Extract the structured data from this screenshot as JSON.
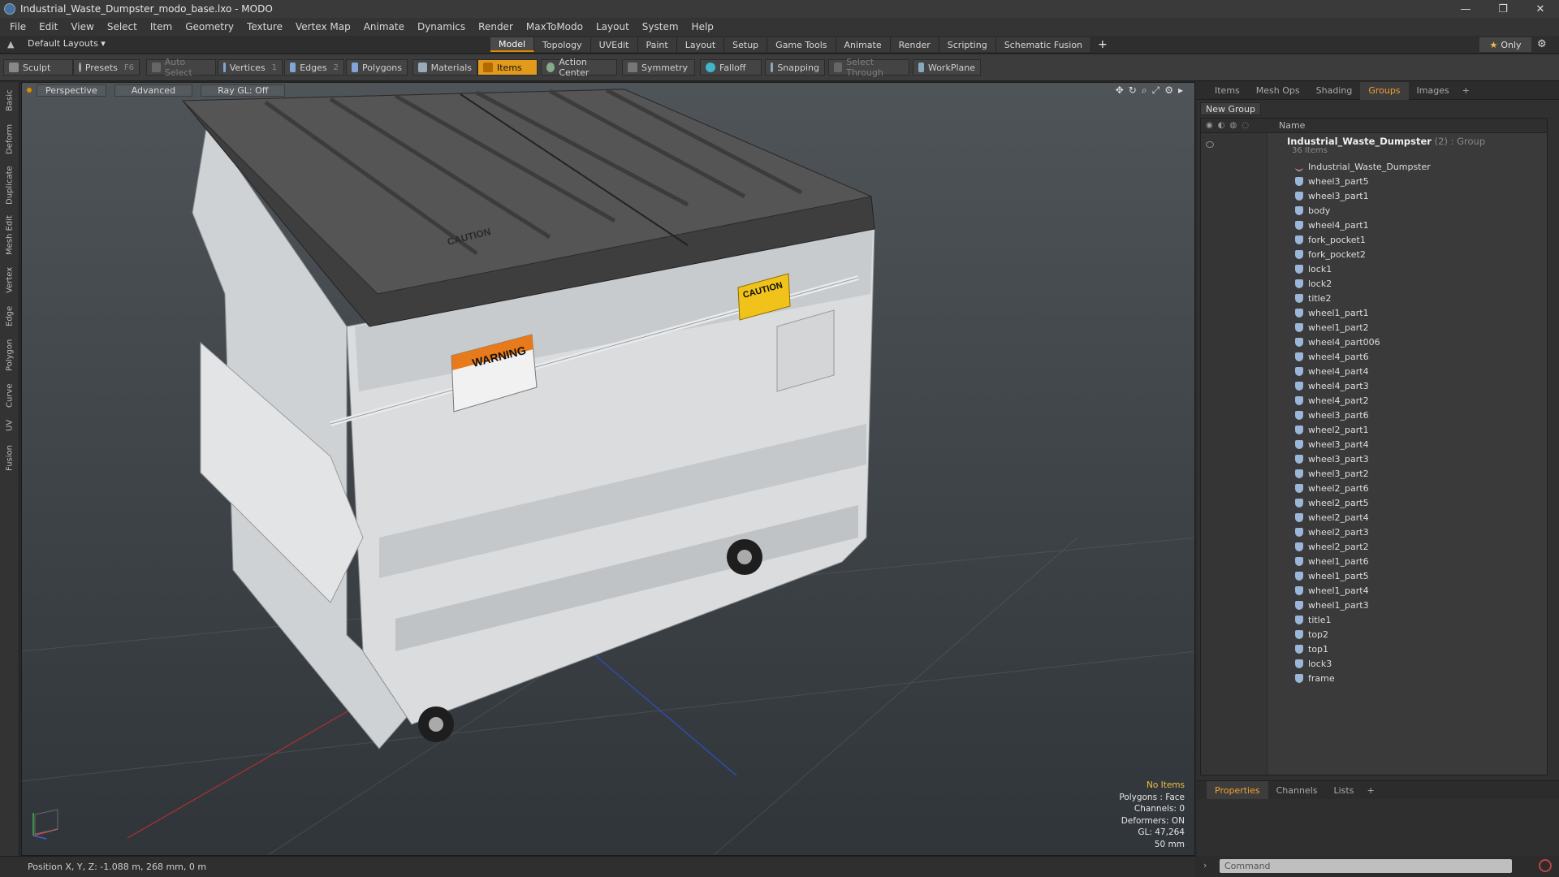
{
  "window": {
    "title": "Industrial_Waste_Dumpster_modo_base.lxo - MODO",
    "min": "—",
    "restore": "❐",
    "close": "✕"
  },
  "menu": [
    "File",
    "Edit",
    "View",
    "Select",
    "Item",
    "Geometry",
    "Texture",
    "Vertex Map",
    "Animate",
    "Dynamics",
    "Render",
    "MaxToModo",
    "Layout",
    "System",
    "Help"
  ],
  "layout": {
    "selector": "Default Layouts ▾",
    "tabs": [
      "Model",
      "Topology",
      "UVEdit",
      "Paint",
      "Layout",
      "Setup",
      "Game Tools",
      "Animate",
      "Render",
      "Scripting",
      "Schematic Fusion"
    ],
    "active_tab": "Model",
    "add": "+",
    "only_star": "★",
    "only_label": "Only",
    "gear": "⚙"
  },
  "toolbar": {
    "sculpt": "Sculpt",
    "presets": "Presets",
    "presets_key": "F6",
    "auto_select": "Auto Select",
    "vertices": "Vertices",
    "vertices_count": "1",
    "edges": "Edges",
    "edges_count": "2",
    "polygons": "Polygons",
    "materials": "Materials",
    "items": "Items",
    "action_center": "Action Center",
    "symmetry": "Symmetry",
    "falloff": "Falloff",
    "snapping": "Snapping",
    "select_through": "Select Through",
    "workplane": "WorkPlane"
  },
  "left_tabs": [
    "Basic",
    "Deform",
    "Duplicate",
    "Mesh Edit",
    "Vertex",
    "Edge",
    "Polygon",
    "Curve",
    "UV",
    "Fusion"
  ],
  "viewport": {
    "view": "Perspective",
    "shading": "Advanced",
    "raygl": "Ray GL: Off",
    "info": {
      "items": "No Items",
      "polygons": "Polygons : Face",
      "channels": "Channels: 0",
      "deformers": "Deformers: ON",
      "gl": "GL: 47,264",
      "focal": "50 mm"
    },
    "decal_warning": "WARNING",
    "decal_caution": "CAUTION",
    "lid_text": "CAUTION"
  },
  "status": {
    "position": "Position X, Y, Z:   -1.088 m, 268 mm, 0 m"
  },
  "right_panel": {
    "tabs": [
      "Items",
      "Mesh Ops",
      "Shading",
      "Groups",
      "Images"
    ],
    "active_tab": "Groups",
    "add": "+",
    "new_group": "New Group",
    "col_name": "Name",
    "group": {
      "name": "Industrial_Waste_Dumpster",
      "meta": " (2) : Group",
      "count": "36 Items"
    },
    "items": [
      "Industrial_Waste_Dumpster",
      "wheel3_part5",
      "wheel3_part1",
      "body",
      "wheel4_part1",
      "fork_pocket1",
      "fork_pocket2",
      "lock1",
      "lock2",
      "title2",
      "wheel1_part1",
      "wheel1_part2",
      "wheel4_part006",
      "wheel4_part6",
      "wheel4_part4",
      "wheel4_part3",
      "wheel4_part2",
      "wheel3_part6",
      "wheel2_part1",
      "wheel3_part4",
      "wheel3_part3",
      "wheel3_part2",
      "wheel2_part6",
      "wheel2_part5",
      "wheel2_part4",
      "wheel2_part3",
      "wheel2_part2",
      "wheel1_part6",
      "wheel1_part5",
      "wheel1_part4",
      "wheel1_part3",
      "title1",
      "top2",
      "top1",
      "lock3",
      "frame"
    ],
    "props_tabs": [
      "Properties",
      "Channels",
      "Lists"
    ],
    "props_active": "Properties",
    "command_placeholder": "Command"
  }
}
